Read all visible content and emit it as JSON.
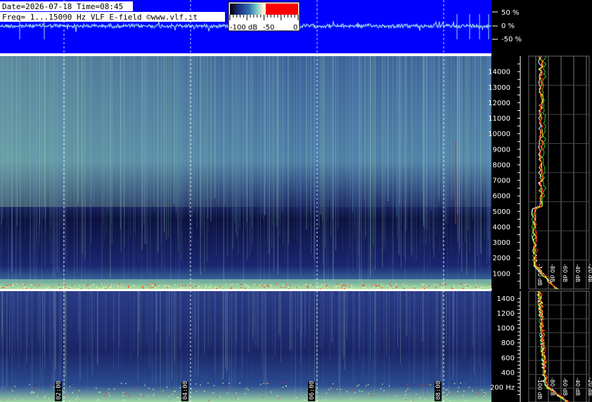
{
  "header": {
    "line1": "Date=2026-07-18 Time=08:45",
    "line2": "Freq= 1...15000 Hz   VLF E-field ©www.vlf.it"
  },
  "colorbar": {
    "labels": [
      "-100 dB",
      "-50",
      "0"
    ],
    "stops": [
      "#000000",
      "#1a2a7a",
      "#2f6fb0",
      "#7fd0c8",
      "#f4f0c8",
      "#ffffff",
      "#ff0000",
      "#ff0000"
    ]
  },
  "waveform": {
    "labels": [
      "50 %",
      "0 %",
      "-50 %"
    ],
    "background": "#0000ff",
    "trace_color": "#9ad9e8"
  },
  "colors": {
    "background": "#000000",
    "spectrogram_dark": "#0a0c33",
    "spectrogram_mid": "#2b3a8a",
    "spectrogram_bright": "#8fd6a0",
    "profile_white": "#ffffff",
    "profile_red": "#ff2a00",
    "profile_green": "#33cc33",
    "profile_yellow": "#ffee00"
  },
  "chart_data": [
    {
      "type": "heatmap",
      "title": "",
      "xlabel": "",
      "ylabel": "",
      "x_ticks": [
        "02:00",
        "04:00",
        "06:00",
        "08:00"
      ],
      "y_ticks": [
        1000,
        2000,
        3000,
        4000,
        5000,
        6000,
        7000,
        8000,
        9000,
        10000,
        11000,
        12000,
        13000,
        14000
      ],
      "ylim": [
        0,
        15000
      ],
      "profile_x_ticks": [
        "-100 dB",
        "-80 dB",
        "-60 dB",
        "-40 dB",
        "-20 dB"
      ],
      "intensity_range_db": [
        -100,
        0
      ]
    },
    {
      "type": "heatmap",
      "title": "",
      "xlabel": "",
      "ylabel": "",
      "x_ticks": [
        "02:00",
        "04:00",
        "06:00",
        "08:00"
      ],
      "y_ticks": [
        "200 Hz",
        "400",
        "600",
        "800",
        "1000",
        "1200",
        "1400"
      ],
      "ylim": [
        0,
        1500
      ],
      "profile_x_ticks": [
        "-100 dB",
        "-80 dB",
        "-60 dB",
        "-40 dB",
        "-20 dB"
      ],
      "intensity_range_db": [
        -100,
        0
      ]
    }
  ]
}
